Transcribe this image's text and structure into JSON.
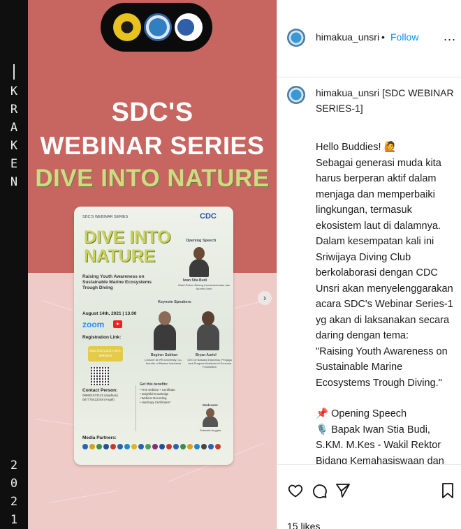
{
  "post_image": {
    "side_text_top": [
      "K",
      "R",
      "A",
      "K",
      "E",
      "N"
    ],
    "side_text_bottom": [
      "2",
      "0",
      "2",
      "1"
    ],
    "heading_line1": "SDC'S",
    "heading_line2": "WEBINAR SERIES",
    "heading_line3": "DIVE INTO NATURE",
    "poster": {
      "series": "SDC'S WEBINAR SERIES",
      "title_line1": "DIVE INTO",
      "title_line2": "NATURE",
      "subtitle": "Raising Youth Awareness on Sustainable Marine Ecosystems Trough Diving",
      "brand": "CDC",
      "opening_speech_label": "Opening Speech",
      "opening_speaker": "Iwan Stia Budi",
      "opening_speaker_role": "Wakil Rektor Bidang Kemahasiswaan dan Alumni Unsri",
      "keynote_label": "Keynote Speakers",
      "speaker1_name": "Beginer Subhan",
      "speaker1_role": "Lecturer at IPB University, Co-founder of Baresa Indonesia",
      "speaker2_name": "Bryan Auriol",
      "speaker2_role": "CEO of Nasaea Indonesia, Penjaga Laut Program Assistant at Econusa Foundation",
      "date": "August 14th, 2021 | 13.00",
      "zoom": "zoom",
      "registration_label": "Registration Link:",
      "registration_link": "https://bit.ly/2021-SDC-Webinars",
      "contact_label": "Contact Person:",
      "contact_values": "089601073122 (Sephian)\n087775422248 (Angel)",
      "benefits_label": "Get this benefits:",
      "benefits": "• Free webinar + Certificate\n• Insightful Knowledge\n• Webinar Recording\n• Hardcopy Certificates*",
      "moderator_label": "Moderator",
      "moderator_name": "Sebastia Anggita",
      "media_partners_label": "Media Partners:"
    }
  },
  "panel": {
    "header": {
      "username": "himakua_unsri",
      "separator": "•",
      "follow": "Follow",
      "more": "..."
    },
    "caption_user": "himakua_unsri",
    "caption_title": "[SDC WEBINAR SERIES-1]",
    "caption_lines": [
      "Hello Buddies! 🙋",
      "Sebagai generasi muda kita harus berperan aktif dalam menjaga dan memperbaiki lingkungan, termasuk ekosistem laut di dalamnya. Dalam kesempatan kali ini Sriwijaya Diving Club berkolaborasi dengan CDC Unsri akan menyelenggarakan acara SDC's Webinar Series-1 yg akan di laksanakan secara daring dengan tema:",
      "\"Raising Youth Awareness on Sustainable Marine Ecosystems Trough Diving.\""
    ],
    "opening_line": "📌 Opening Speech",
    "speaker_line": "🎙️ Bapak Iwan Stia Budi, S.KM. M.Kes - Wakil Rektor Bidang Kemahasiswaan dan Alumni Universitas Sriwijaya",
    "likes": "15 likes"
  },
  "colors": {
    "top": "#c76660",
    "bottom": "#efcbc7",
    "follow": "#0095f6"
  },
  "icons": [
    "heart-icon",
    "comment-icon",
    "share-icon",
    "bookmark-icon",
    "next-arrow-icon",
    "more-options-icon"
  ]
}
